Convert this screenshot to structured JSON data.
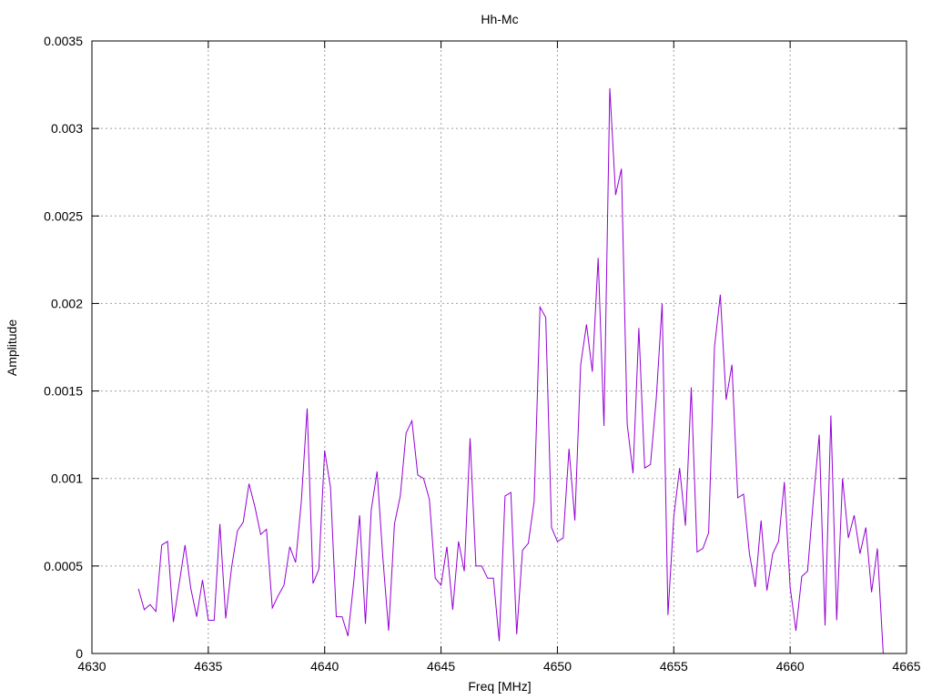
{
  "chart_data": {
    "type": "line",
    "title": "Hh-Mc",
    "xlabel": "Freq [MHz]",
    "ylabel": "Amplitude",
    "xlim": [
      4630,
      4665
    ],
    "ylim": [
      0,
      0.0035
    ],
    "grid": true,
    "xticks": [
      "4630",
      "4635",
      "4640",
      "4645",
      "4650",
      "4655",
      "4660",
      "4665"
    ],
    "yticks": [
      "0",
      "0.0005",
      "0.001",
      "0.0015",
      "0.002",
      "0.0025",
      "0.003",
      "0.0035"
    ],
    "series": [
      {
        "color": "#9400d3",
        "x": [
          4632.0,
          4632.25,
          4632.5,
          4632.75,
          4633.0,
          4633.25,
          4633.5,
          4633.75,
          4634.0,
          4634.25,
          4634.5,
          4634.75,
          4635.0,
          4635.25,
          4635.5,
          4635.75,
          4636.0,
          4636.25,
          4636.5,
          4636.75,
          4637.0,
          4637.25,
          4637.5,
          4637.75,
          4638.0,
          4638.25,
          4638.5,
          4638.75,
          4639.0,
          4639.25,
          4639.5,
          4639.75,
          4640.0,
          4640.25,
          4640.5,
          4640.75,
          4641.0,
          4641.25,
          4641.5,
          4641.75,
          4642.0,
          4642.25,
          4642.5,
          4642.75,
          4643.0,
          4643.25,
          4643.5,
          4643.75,
          4644.0,
          4644.25,
          4644.5,
          4644.75,
          4645.0,
          4645.25,
          4645.5,
          4645.75,
          4646.0,
          4646.25,
          4646.5,
          4646.75,
          4647.0,
          4647.25,
          4647.5,
          4647.75,
          4648.0,
          4648.25,
          4648.5,
          4648.75,
          4649.0,
          4649.25,
          4649.5,
          4649.75,
          4650.0,
          4650.25,
          4650.5,
          4650.75,
          4651.0,
          4651.25,
          4651.5,
          4651.75,
          4652.0,
          4652.25,
          4652.5,
          4652.75,
          4653.0,
          4653.25,
          4653.5,
          4653.75,
          4654.0,
          4654.25,
          4654.5,
          4654.75,
          4655.0,
          4655.25,
          4655.5,
          4655.75,
          4656.0,
          4656.25,
          4656.5,
          4656.75,
          4657.0,
          4657.25,
          4657.5,
          4657.75,
          4658.0,
          4658.25,
          4658.5,
          4658.75,
          4659.0,
          4659.25,
          4659.5,
          4659.75,
          4660.0,
          4660.25,
          4660.5,
          4660.75,
          4661.0,
          4661.25,
          4661.5,
          4661.75,
          4662.0,
          4662.25,
          4662.5,
          4662.75,
          4663.0,
          4663.25,
          4663.5,
          4663.75,
          4664.0
        ],
        "y": [
          0.00037,
          0.00025,
          0.00028,
          0.00024,
          0.00062,
          0.00064,
          0.00018,
          0.0004,
          0.00062,
          0.00037,
          0.00021,
          0.00042,
          0.00019,
          0.00019,
          0.00074,
          0.0002,
          0.00049,
          0.0007,
          0.00075,
          0.00097,
          0.00084,
          0.00068,
          0.00071,
          0.00026,
          0.00033,
          0.00039,
          0.00061,
          0.00052,
          0.00087,
          0.0014,
          0.0004,
          0.00048,
          0.00116,
          0.00095,
          0.00021,
          0.00021,
          0.0001,
          0.00041,
          0.00079,
          0.00017,
          0.00082,
          0.00104,
          0.00055,
          0.00013,
          0.00074,
          0.0009,
          0.00126,
          0.00133,
          0.00102,
          0.001,
          0.00088,
          0.00043,
          0.00039,
          0.00061,
          0.00025,
          0.00064,
          0.00047,
          0.00123,
          0.0005,
          0.0005,
          0.00043,
          0.00043,
          7e-05,
          0.0009,
          0.00092,
          0.00011,
          0.00059,
          0.00063,
          0.00087,
          0.00198,
          0.00192,
          0.00072,
          0.00064,
          0.00066,
          0.00117,
          0.00076,
          0.00165,
          0.00188,
          0.00161,
          0.00226,
          0.0013,
          0.00323,
          0.00262,
          0.00277,
          0.00131,
          0.00103,
          0.00186,
          0.00106,
          0.00108,
          0.00146,
          0.002,
          0.00022,
          0.00078,
          0.00106,
          0.00073,
          0.00152,
          0.00058,
          0.0006,
          0.00069,
          0.00175,
          0.00205,
          0.00145,
          0.00165,
          0.00089,
          0.00091,
          0.00057,
          0.00038,
          0.00076,
          0.00036,
          0.00057,
          0.00064,
          0.00098,
          0.00038,
          0.00013,
          0.00044,
          0.00047,
          0.00088,
          0.00125,
          0.00016,
          0.00136,
          0.00019,
          0.001,
          0.00066,
          0.00079,
          0.00057,
          0.00072,
          0.00035,
          0.0006,
          0.0
        ]
      }
    ]
  }
}
